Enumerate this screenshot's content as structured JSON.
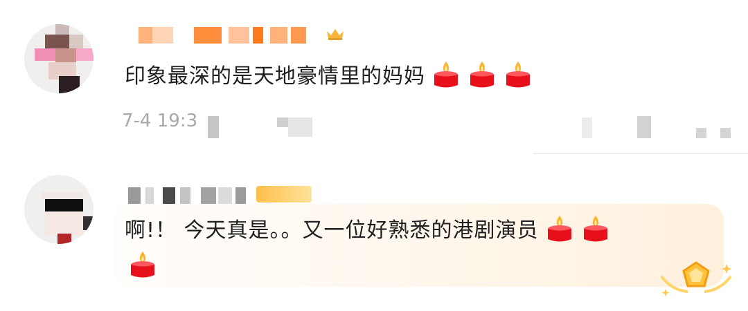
{
  "comments": [
    {
      "text": "印象最深的是天地豪情里的妈妈",
      "timestamp": "7-4 19:3",
      "reaction_icons": [
        "candle-icon",
        "candle-icon",
        "candle-icon"
      ]
    },
    {
      "text": "啊!！ 今天真是。。又一位好熟悉的港剧演员",
      "reaction_icons": [
        "candle-icon",
        "candle-icon",
        "candle-icon"
      ]
    }
  ],
  "colors": {
    "text": "#1f1f1f",
    "meta": "#a8a8a8",
    "highlight_bg": "#fff3e3",
    "username_orange": "#ff7a1a",
    "candle_red": "#e8111b",
    "flame": "#ffb32c"
  }
}
